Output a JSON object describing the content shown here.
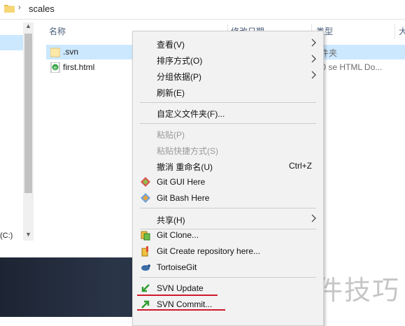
{
  "address": {
    "path": "scales"
  },
  "nav": {
    "drive_label": "(C:)"
  },
  "columns": [
    "名称",
    "修改日期",
    "类型",
    "大"
  ],
  "files": [
    {
      "name": ".svn",
      "type": "文件夹",
      "selected": true,
      "icon": "folder-icon"
    },
    {
      "name": "first.html",
      "type": "360 se HTML Do...",
      "selected": false,
      "icon": "html-file-icon"
    }
  ],
  "menu": {
    "view": "查看(V)",
    "sort": "排序方式(O)",
    "group": "分组依据(P)",
    "refresh": "刷新(E)",
    "customize": "自定义文件夹(F)...",
    "paste": "粘贴(P)",
    "paste_shortcut": "粘贴快捷方式(S)",
    "undo": "撤消 重命名(U)",
    "undo_shortcut": "Ctrl+Z",
    "git_gui": "Git GUI Here",
    "git_bash": "Git Bash Here",
    "share": "共享(H)",
    "git_clone": "Git Clone...",
    "git_create": "Git Create repository here...",
    "tortoisegit": "TortoiseGit",
    "svn_update": "SVN Update",
    "svn_commit": "SVN Commit..."
  },
  "watermark": "软件技巧",
  "colors": {
    "selection": "#cce8ff",
    "underline": "#d0192b",
    "menu_bg": "#f2f2f2"
  }
}
